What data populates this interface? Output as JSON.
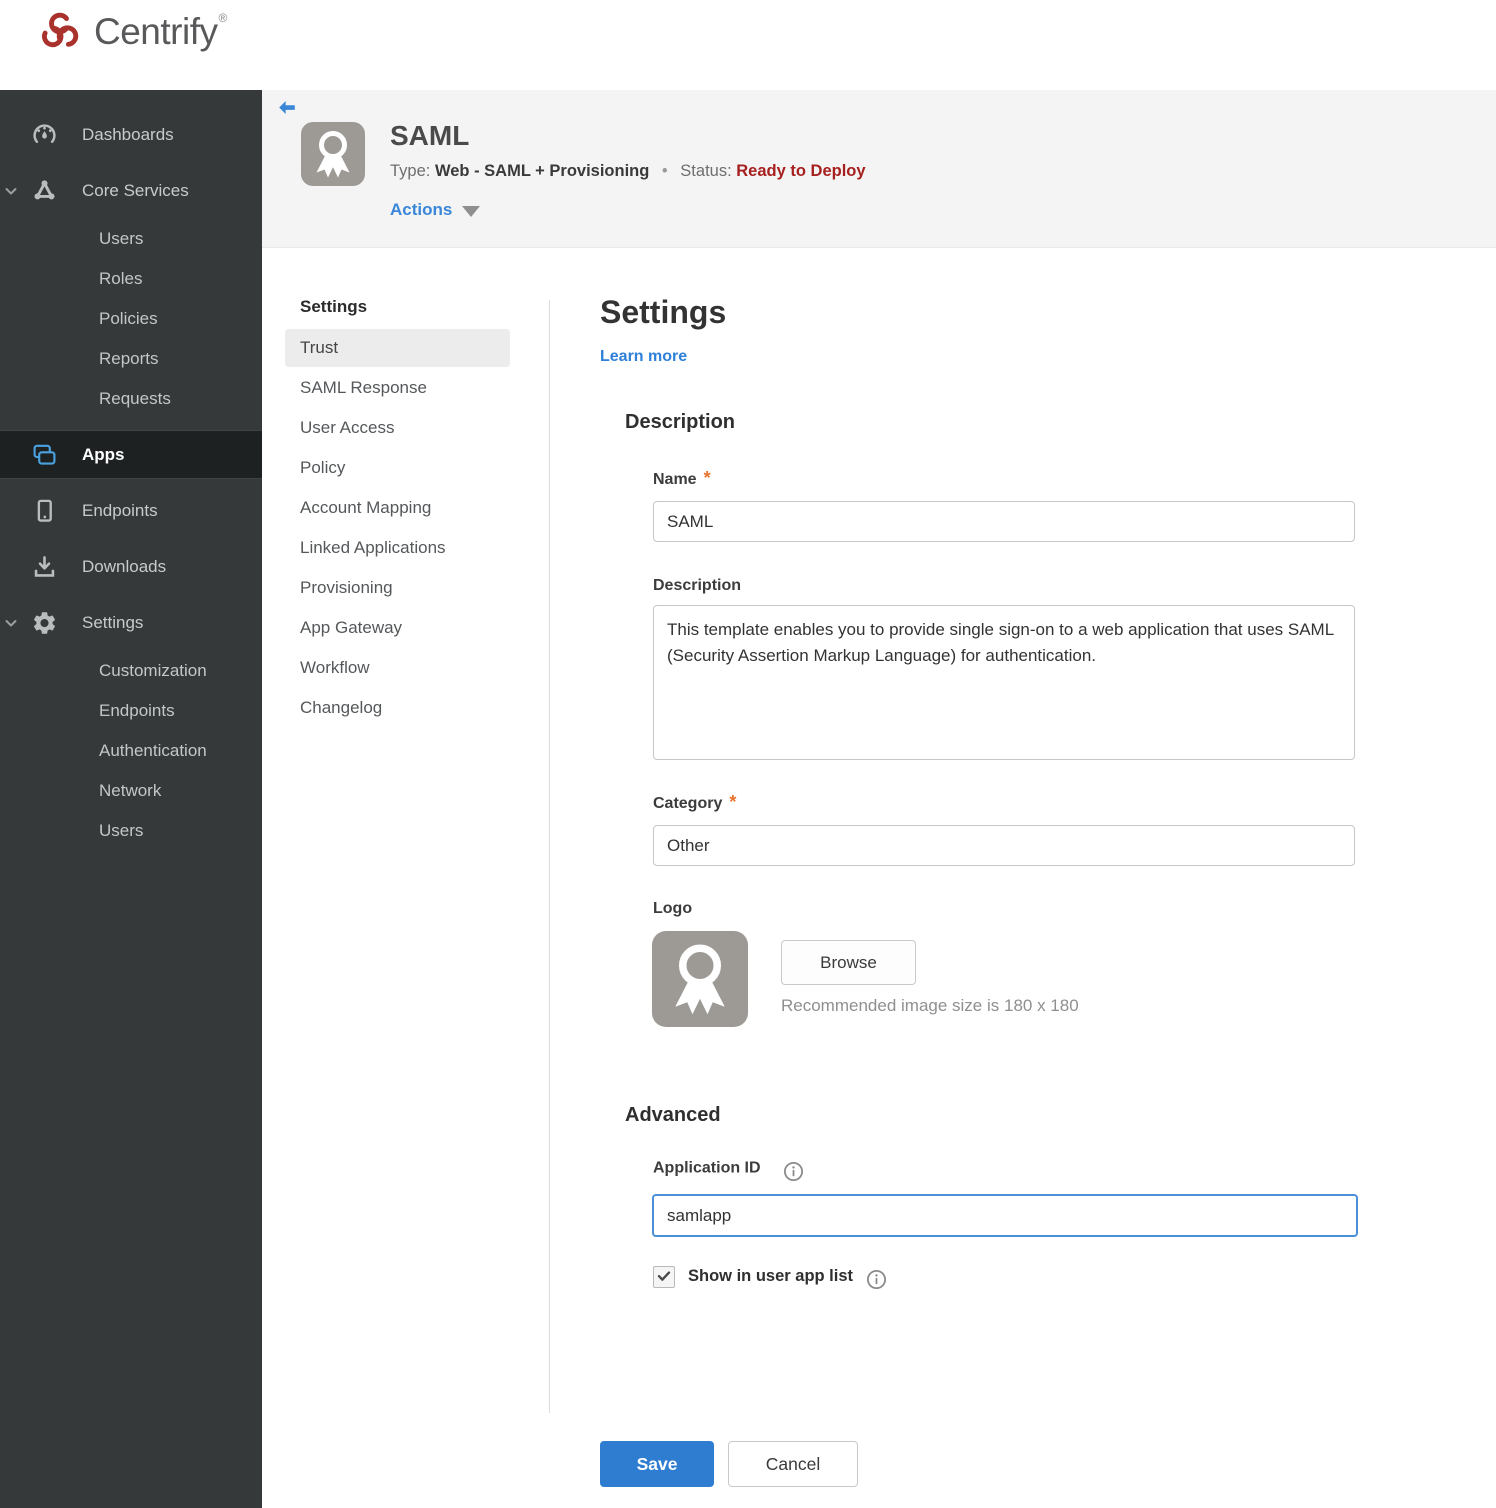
{
  "colors": {
    "sidebar_bg": "#35393a",
    "sidebar_active_bg": "#1d2122",
    "accent_blue": "#3a86d8",
    "apps_icon_blue": "#4aa3e0",
    "status_red": "#a6201f",
    "brand_red": "#a9322d",
    "save_button_blue": "#2f7dd1",
    "required_orange": "#e8732a",
    "band_gray": "#f4f4f4"
  },
  "required_marker": "*",
  "brand": {
    "name": "Centrify",
    "registered_mark": "®"
  },
  "sidebar": {
    "items": [
      {
        "label": "Dashboards"
      },
      {
        "label": "Core Services"
      },
      {
        "label": "Users"
      },
      {
        "label": "Roles"
      },
      {
        "label": "Policies"
      },
      {
        "label": "Reports"
      },
      {
        "label": "Requests"
      },
      {
        "label": "Apps"
      },
      {
        "label": "Endpoints"
      },
      {
        "label": "Downloads"
      },
      {
        "label": "Settings"
      },
      {
        "label": "Customization"
      },
      {
        "label": "Endpoints"
      },
      {
        "label": "Authentication"
      },
      {
        "label": "Network"
      },
      {
        "label": "Users"
      }
    ]
  },
  "app_header": {
    "title": "SAML",
    "type_label": "Type:",
    "type_value": "Web - SAML + Provisioning",
    "separator": "•",
    "status_label": "Status:",
    "status_value": "Ready to Deploy",
    "actions_label": "Actions"
  },
  "subnav": {
    "heading": "Settings",
    "items": [
      {
        "label": "Trust"
      },
      {
        "label": "SAML Response"
      },
      {
        "label": "User Access"
      },
      {
        "label": "Policy"
      },
      {
        "label": "Account Mapping"
      },
      {
        "label": "Linked Applications"
      },
      {
        "label": "Provisioning"
      },
      {
        "label": "App Gateway"
      },
      {
        "label": "Workflow"
      },
      {
        "label": "Changelog"
      }
    ]
  },
  "main": {
    "title": "Settings",
    "learn_more_label": "Learn more",
    "description": {
      "heading": "Description",
      "name_label": "Name",
      "name_value": "SAML",
      "description_label": "Description",
      "description_value": "This template enables you to provide single sign-on to a web application that uses SAML (Security Assertion Markup Language) for authentication.",
      "category_label": "Category",
      "category_value": "Other",
      "logo_label": "Logo",
      "browse_label": "Browse",
      "logo_hint": "Recommended image size is 180 x 180"
    },
    "advanced": {
      "heading": "Advanced",
      "application_id_label": "Application ID",
      "application_id_value": "samlapp",
      "show_in_user_app_list_label": "Show in user app list",
      "checkbox_checked": true
    },
    "footer": {
      "save_label": "Save",
      "cancel_label": "Cancel"
    }
  }
}
